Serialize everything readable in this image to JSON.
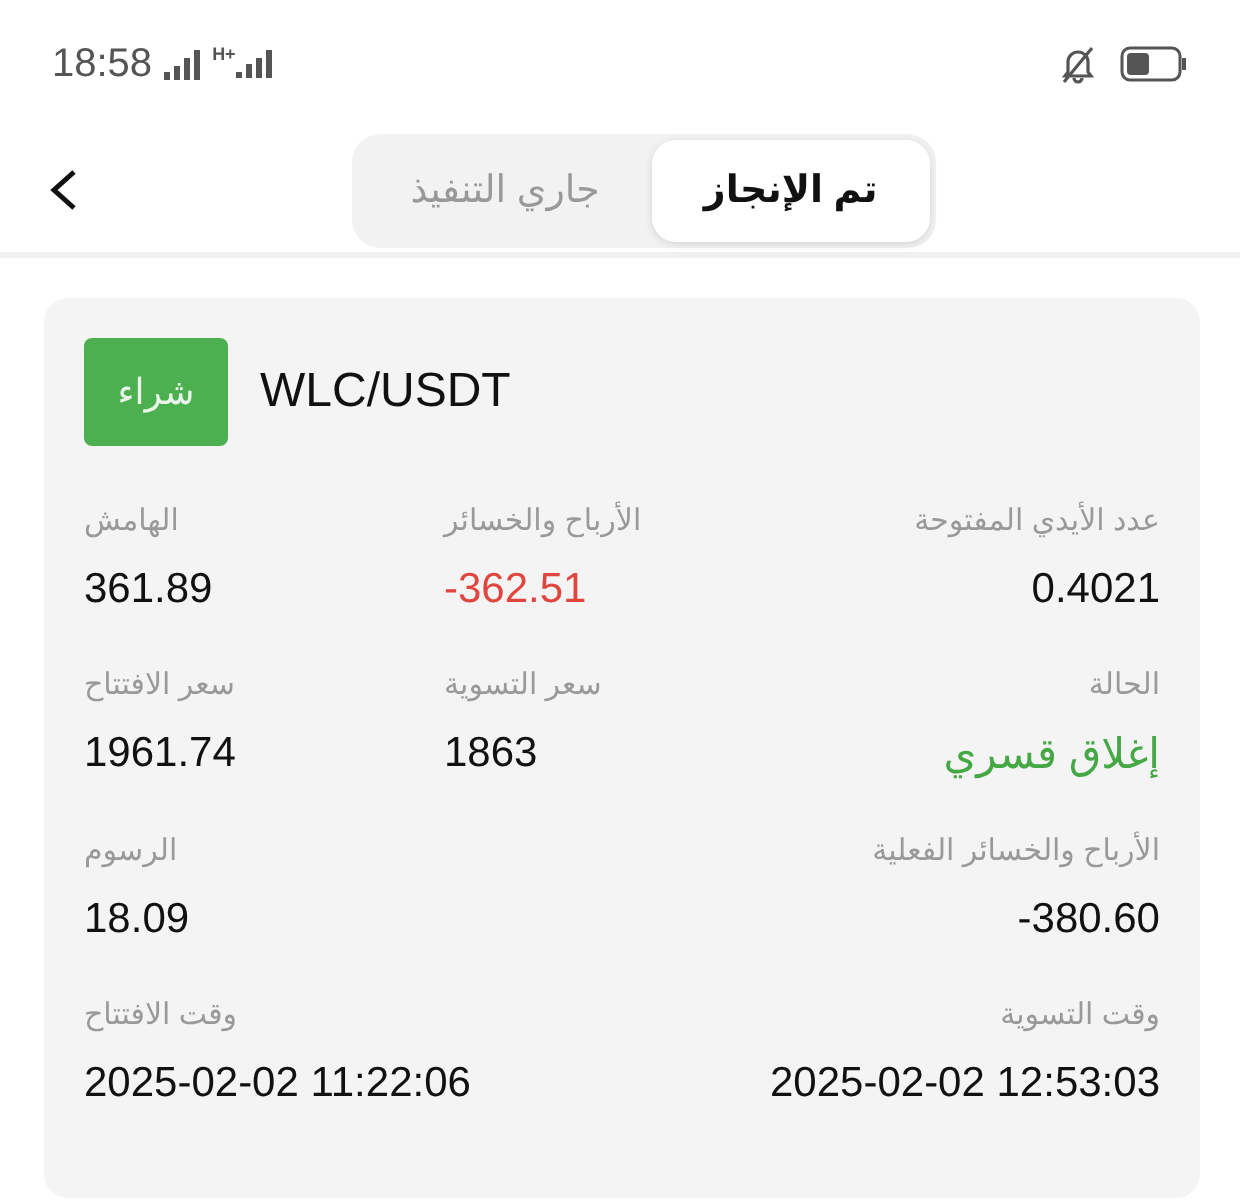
{
  "status_bar": {
    "time": "18:58",
    "network": "H+"
  },
  "tabs": [
    {
      "label": "تم الإنجاز",
      "selected": true
    },
    {
      "label": "جاري التنفيذ",
      "selected": false
    }
  ],
  "order": {
    "side": "شراء",
    "pair": "WLC/USDT",
    "rows": [
      {
        "left": {
          "label": "الهامش",
          "value": "361.89",
          "color": "#111111"
        },
        "middle": {
          "label": "الأرباح والخسائر",
          "value": "-362.51",
          "color": "#e0463e"
        },
        "right": {
          "label": "عدد الأيدي المفتوحة",
          "value": "0.4021",
          "color": "#111111"
        }
      },
      {
        "left": {
          "label": "سعر الافتتاح",
          "value": "1961.74",
          "color": "#111111"
        },
        "middle": {
          "label": "سعر التسوية",
          "value": "1863",
          "color": "#111111"
        },
        "right": {
          "label": "الحالة",
          "value": "إغلاق قسري",
          "color": "#44a845"
        }
      },
      {
        "left": {
          "label": "الرسوم",
          "value": "18.09",
          "color": "#111111"
        },
        "right": {
          "label": "الأرباح والخسائر الفعلية",
          "value": "-380.60",
          "color": "#111111"
        }
      },
      {
        "left": {
          "label": "وقت الافتتاح",
          "value": "2025-02-02 11:22:06",
          "color": "#111111"
        },
        "right": {
          "label": "وقت التسوية",
          "value": "2025-02-02 12:53:03",
          "color": "#111111"
        }
      }
    ]
  }
}
